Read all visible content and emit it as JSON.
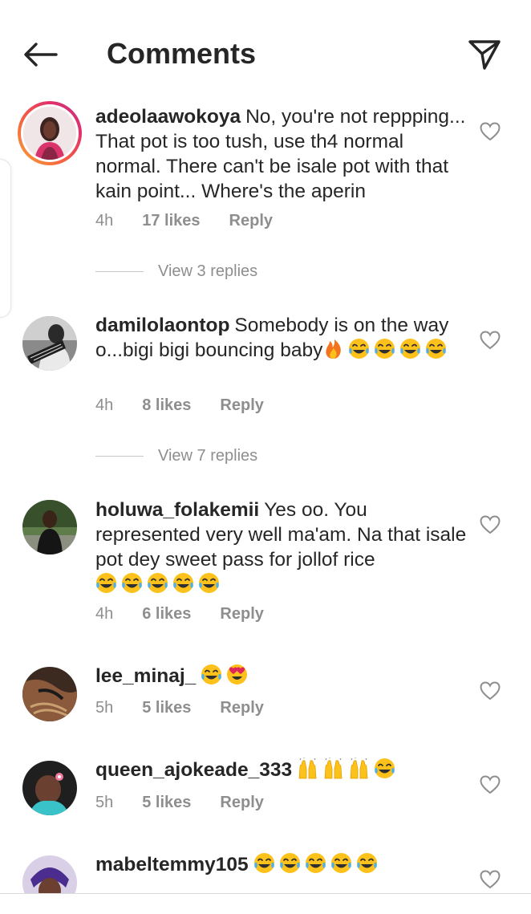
{
  "header": {
    "title": "Comments",
    "back_icon": "arrow-left-icon",
    "share_icon": "paper-plane-icon"
  },
  "comments": [
    {
      "username": "adeolaawokoya",
      "text": "No, you're not reppping... That pot is too tush, use th4 normal normal. There can't be isale pot with that kain point... Where's the aperin",
      "time": "4h",
      "likes": "17 likes",
      "reply": "Reply",
      "view_replies": "View 3 replies",
      "has_story_ring": true
    },
    {
      "username": "damilolaontop",
      "text": "Somebody is on the way o...bigi bigi bouncing baby",
      "emojis": [
        "fire",
        "joy",
        "joy",
        "joy",
        "joy"
      ],
      "time": "4h",
      "likes": "8 likes",
      "reply": "Reply",
      "view_replies": "View 7 replies"
    },
    {
      "username": "holuwa_folakemii",
      "text": "Yes oo. You represented very well ma'am. Na that isale pot dey sweet pass for jollof rice",
      "emojis": [
        "joy",
        "joy",
        "joy",
        "joy",
        "joy"
      ],
      "time": "4h",
      "likes": "6 likes",
      "reply": "Reply"
    },
    {
      "username": "lee_minaj_",
      "text": "",
      "emojis": [
        "joy",
        "heart-eyes"
      ],
      "time": "5h",
      "likes": "5 likes",
      "reply": "Reply"
    },
    {
      "username": "queen_ajokeade_333",
      "text": "",
      "emojis": [
        "raised-hands",
        "raised-hands",
        "raised-hands",
        "joy"
      ],
      "time": "5h",
      "likes": "5 likes",
      "reply": "Reply"
    },
    {
      "username": "mabeltemmy105",
      "text": "",
      "emojis": [
        "joy",
        "joy",
        "joy",
        "joy",
        "joy"
      ]
    }
  ],
  "colors": {
    "text": "#262626",
    "secondary": "#8e8e8e",
    "story_ring_start": "#f9a33a",
    "story_ring_end": "#c13584"
  }
}
